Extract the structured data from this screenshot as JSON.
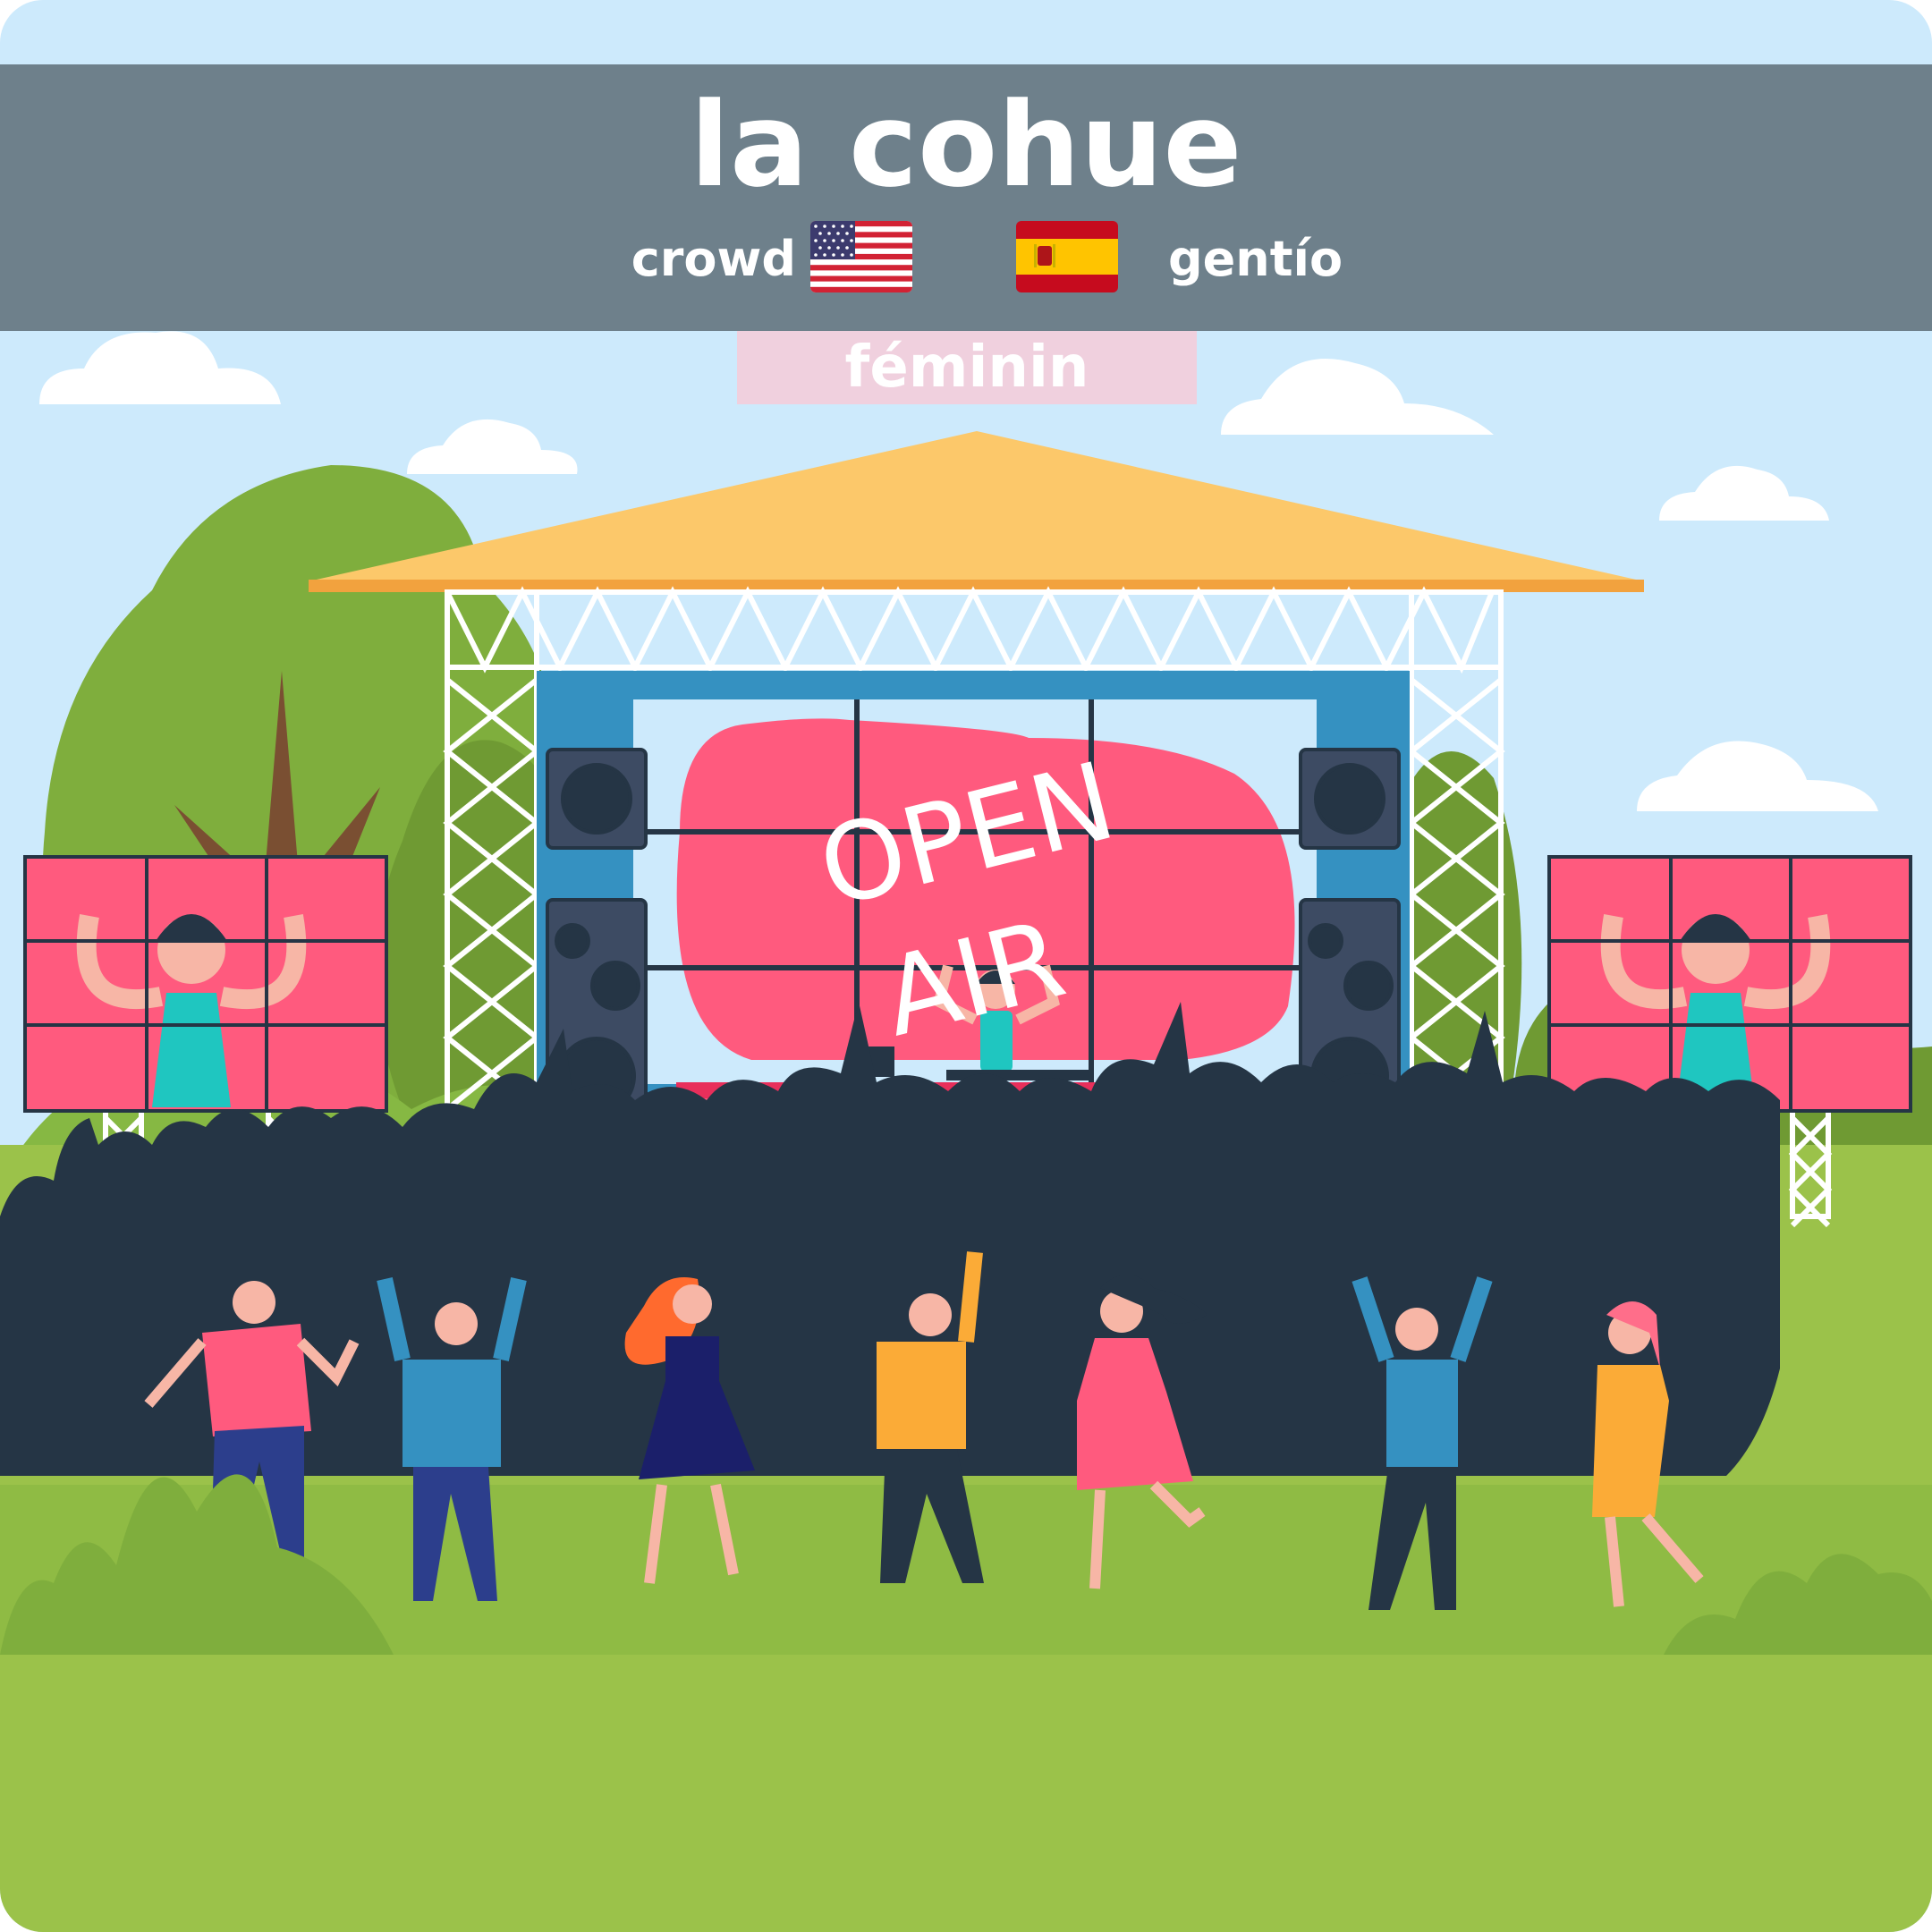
{
  "card": {
    "word": "la cohue",
    "gender": "féminin",
    "translations": {
      "english": "crowd",
      "spanish": "gentío"
    },
    "flags": {
      "english": "us-flag-icon",
      "spanish": "spain-flag-icon"
    }
  },
  "illustration": {
    "stage_sign": [
      "OPEN",
      "AIR"
    ],
    "colors": {
      "sky": "#cdeafc",
      "grass": "#9bc24a",
      "stage_roof": "#fcc86a",
      "screen_pink": "#ff4a6e",
      "crowd_silhouette": "#253545",
      "header_band": "#6e808b",
      "gender_badge": "#f0d0de"
    }
  }
}
